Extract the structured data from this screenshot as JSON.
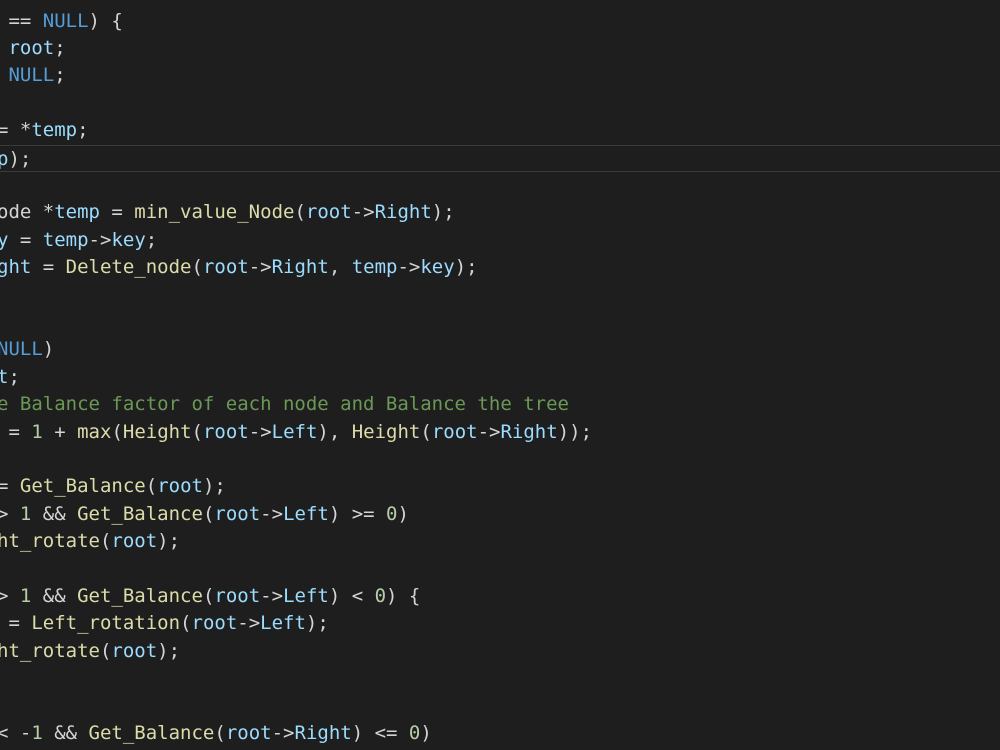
{
  "editor": {
    "theme_colors": {
      "background": "#1e1e1e",
      "plain": "#d4d4d4",
      "variable": "#9cdcfe",
      "function": "#dcdcaa",
      "constant": "#569cd6",
      "number": "#b5cea8",
      "comment": "#6a9955",
      "current_line_border": "#3a3a3a"
    },
    "current_line": 5,
    "lines": [
      [
        {
          "t": " == ",
          "c": "plain"
        },
        {
          "t": "NULL",
          "c": "const"
        },
        {
          "t": ") {",
          "c": "plain"
        }
      ],
      [
        {
          "t": " ",
          "c": "plain"
        },
        {
          "t": "root",
          "c": "var"
        },
        {
          "t": ";",
          "c": "plain"
        }
      ],
      [
        {
          "t": " ",
          "c": "plain"
        },
        {
          "t": "NULL",
          "c": "const"
        },
        {
          "t": ";",
          "c": "plain"
        }
      ],
      [],
      [
        {
          "t": "= *",
          "c": "plain"
        },
        {
          "t": "temp",
          "c": "var"
        },
        {
          "t": ";",
          "c": "plain"
        }
      ],
      [
        {
          "t": "p",
          "c": "var"
        },
        {
          "t": ");",
          "c": "plain"
        }
      ],
      [],
      [
        {
          "t": "ode *",
          "c": "plain"
        },
        {
          "t": "temp",
          "c": "var"
        },
        {
          "t": " = ",
          "c": "plain"
        },
        {
          "t": "min_value_Node",
          "c": "fn"
        },
        {
          "t": "(",
          "c": "plain"
        },
        {
          "t": "root",
          "c": "var"
        },
        {
          "t": "->",
          "c": "plain"
        },
        {
          "t": "Right",
          "c": "var"
        },
        {
          "t": ");",
          "c": "plain"
        }
      ],
      [
        {
          "t": "y",
          "c": "var"
        },
        {
          "t": " = ",
          "c": "plain"
        },
        {
          "t": "temp",
          "c": "var"
        },
        {
          "t": "->",
          "c": "plain"
        },
        {
          "t": "key",
          "c": "var"
        },
        {
          "t": ";",
          "c": "plain"
        }
      ],
      [
        {
          "t": "ght",
          "c": "var"
        },
        {
          "t": " = ",
          "c": "plain"
        },
        {
          "t": "Delete_node",
          "c": "fn"
        },
        {
          "t": "(",
          "c": "plain"
        },
        {
          "t": "root",
          "c": "var"
        },
        {
          "t": "->",
          "c": "plain"
        },
        {
          "t": "Right",
          "c": "var"
        },
        {
          "t": ", ",
          "c": "plain"
        },
        {
          "t": "temp",
          "c": "var"
        },
        {
          "t": "->",
          "c": "plain"
        },
        {
          "t": "key",
          "c": "var"
        },
        {
          "t": ");",
          "c": "plain"
        }
      ],
      [],
      [],
      [
        {
          "t": "NULL",
          "c": "const"
        },
        {
          "t": ")",
          "c": "plain"
        }
      ],
      [
        {
          "t": "t",
          "c": "var"
        },
        {
          "t": ";",
          "c": "plain"
        }
      ],
      [
        {
          "t": "e Balance factor of each node and Balance the tree",
          "c": "comment"
        }
      ],
      [
        {
          "t": " = ",
          "c": "plain"
        },
        {
          "t": "1",
          "c": "num"
        },
        {
          "t": " + ",
          "c": "plain"
        },
        {
          "t": "max",
          "c": "fn"
        },
        {
          "t": "(",
          "c": "plain"
        },
        {
          "t": "Height",
          "c": "fn"
        },
        {
          "t": "(",
          "c": "plain"
        },
        {
          "t": "root",
          "c": "var"
        },
        {
          "t": "->",
          "c": "plain"
        },
        {
          "t": "Left",
          "c": "var"
        },
        {
          "t": "), ",
          "c": "plain"
        },
        {
          "t": "Height",
          "c": "fn"
        },
        {
          "t": "(",
          "c": "plain"
        },
        {
          "t": "root",
          "c": "var"
        },
        {
          "t": "->",
          "c": "plain"
        },
        {
          "t": "Right",
          "c": "var"
        },
        {
          "t": "));",
          "c": "plain"
        }
      ],
      [],
      [
        {
          "t": "= ",
          "c": "plain"
        },
        {
          "t": "Get_Balance",
          "c": "fn"
        },
        {
          "t": "(",
          "c": "plain"
        },
        {
          "t": "root",
          "c": "var"
        },
        {
          "t": ");",
          "c": "plain"
        }
      ],
      [
        {
          "t": "> ",
          "c": "plain"
        },
        {
          "t": "1",
          "c": "num"
        },
        {
          "t": " && ",
          "c": "plain"
        },
        {
          "t": "Get_Balance",
          "c": "fn"
        },
        {
          "t": "(",
          "c": "plain"
        },
        {
          "t": "root",
          "c": "var"
        },
        {
          "t": "->",
          "c": "plain"
        },
        {
          "t": "Left",
          "c": "var"
        },
        {
          "t": ") >= ",
          "c": "plain"
        },
        {
          "t": "0",
          "c": "num"
        },
        {
          "t": ")",
          "c": "plain"
        }
      ],
      [
        {
          "t": "ht_rotate",
          "c": "fn"
        },
        {
          "t": "(",
          "c": "plain"
        },
        {
          "t": "root",
          "c": "var"
        },
        {
          "t": ");",
          "c": "plain"
        }
      ],
      [],
      [
        {
          "t": "> ",
          "c": "plain"
        },
        {
          "t": "1",
          "c": "num"
        },
        {
          "t": " && ",
          "c": "plain"
        },
        {
          "t": "Get_Balance",
          "c": "fn"
        },
        {
          "t": "(",
          "c": "plain"
        },
        {
          "t": "root",
          "c": "var"
        },
        {
          "t": "->",
          "c": "plain"
        },
        {
          "t": "Left",
          "c": "var"
        },
        {
          "t": ") < ",
          "c": "plain"
        },
        {
          "t": "0",
          "c": "num"
        },
        {
          "t": ") {",
          "c": "plain"
        }
      ],
      [
        {
          "t": " = ",
          "c": "plain"
        },
        {
          "t": "Left_rotation",
          "c": "fn"
        },
        {
          "t": "(",
          "c": "plain"
        },
        {
          "t": "root",
          "c": "var"
        },
        {
          "t": "->",
          "c": "plain"
        },
        {
          "t": "Left",
          "c": "var"
        },
        {
          "t": ");",
          "c": "plain"
        }
      ],
      [
        {
          "t": "ht_rotate",
          "c": "fn"
        },
        {
          "t": "(",
          "c": "plain"
        },
        {
          "t": "root",
          "c": "var"
        },
        {
          "t": ");",
          "c": "plain"
        }
      ],
      [],
      [],
      [
        {
          "t": "< -",
          "c": "plain"
        },
        {
          "t": "1",
          "c": "num"
        },
        {
          "t": " && ",
          "c": "plain"
        },
        {
          "t": "Get_Balance",
          "c": "fn"
        },
        {
          "t": "(",
          "c": "plain"
        },
        {
          "t": "root",
          "c": "var"
        },
        {
          "t": "->",
          "c": "plain"
        },
        {
          "t": "Right",
          "c": "var"
        },
        {
          "t": ") <= ",
          "c": "plain"
        },
        {
          "t": "0",
          "c": "num"
        },
        {
          "t": ")",
          "c": "plain"
        }
      ]
    ]
  }
}
